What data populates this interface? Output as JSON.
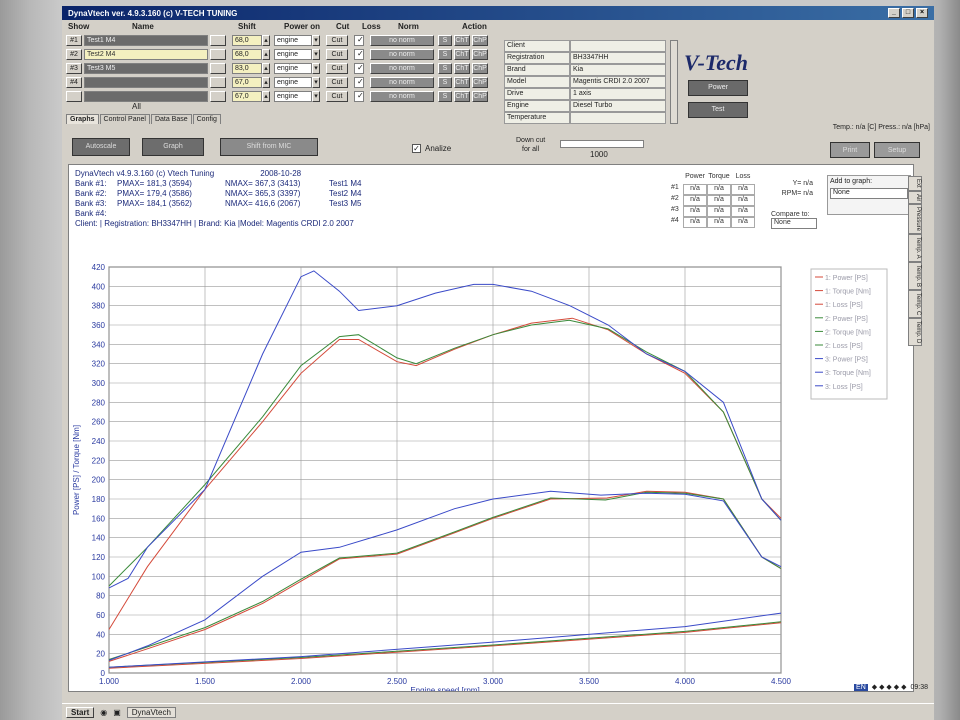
{
  "window": {
    "title": "DynaVtech ver. 4.9.3.160 (c) V-TECH TUNING"
  },
  "table_headers": {
    "show": "Show",
    "name": "Name",
    "shift": "Shift",
    "power_on": "Power on",
    "cut": "Cut",
    "loss": "Loss",
    "norm": "Norm",
    "action": "Action"
  },
  "runs": [
    {
      "id": "#1",
      "name": "Test1 M4",
      "shift": "68,0",
      "power_on": "engine",
      "cut": "Cut",
      "norm": "no norm"
    },
    {
      "id": "#2",
      "name": "Test2 M4",
      "shift": "68,0",
      "power_on": "engine",
      "cut": "Cut",
      "norm": "no norm"
    },
    {
      "id": "#3",
      "name": "Test3 M5",
      "shift": "83,0",
      "power_on": "engine",
      "cut": "Cut",
      "norm": "no norm"
    },
    {
      "id": "#4",
      "name": "",
      "shift": "67,0",
      "power_on": "engine",
      "cut": "Cut",
      "norm": "no norm"
    },
    {
      "id": "",
      "name": "",
      "shift": "67,0",
      "power_on": "engine",
      "cut": "Cut",
      "norm": "no norm"
    }
  ],
  "all_label": "All",
  "action_labels": {
    "s": "S",
    "cht": "ChT",
    "chp": "ChP"
  },
  "vehicle_info": [
    {
      "key": "Client",
      "value": ""
    },
    {
      "key": "Registration",
      "value": "BH3347HH"
    },
    {
      "key": "Brand",
      "value": "Kia"
    },
    {
      "key": "Model",
      "value": "Magentis CRDI 2.0 2007"
    },
    {
      "key": "Drive",
      "value": "1 axis"
    },
    {
      "key": "Engine",
      "value": "Diesel Turbo"
    },
    {
      "key": "Temperature",
      "value": ""
    }
  ],
  "logo": "V-Tech",
  "power_button": "Power",
  "test_button": "Test",
  "tabs": [
    "Graphs",
    "Control Panel",
    "Data Base",
    "Config"
  ],
  "temps_text": "Temp.: n/a [C]   Press.: n/a [hPa]",
  "toolbar": {
    "autoscale": "Autoscale",
    "graph": "Graph",
    "shift_from_mic": "Shift from MIC",
    "analize": "Analize",
    "down_cut_label": "Down cut",
    "for_all": "for all",
    "down_cut_value": "1000",
    "print": "Print",
    "setup": "Setup"
  },
  "info": {
    "app_line": "DynaVtech v4.9.3.160 (c) Vtech Tuning",
    "date": "2008-10-28",
    "banks": [
      {
        "label": "Bank #1:",
        "pmax": "PMAX= 181,3 (3594)",
        "nmax": "NMAX= 367,3 (3413)",
        "name": "Test1 M4"
      },
      {
        "label": "Bank #2:",
        "pmax": "PMAX= 179,4 (3586)",
        "nmax": "NMAX= 365,3 (3397)",
        "name": "Test2 M4"
      },
      {
        "label": "Bank #3:",
        "pmax": "PMAX= 184,1 (3562)",
        "nmax": "NMAX= 416,6 (2067)",
        "name": "Test3 M5"
      },
      {
        "label": "Bank #4:",
        "pmax": "",
        "nmax": "",
        "name": ""
      }
    ],
    "client_line": "Client:   | Registration:  BH3347HH | Brand: Kia |Model:  Magentis CRDI 2.0 2007"
  },
  "cursor_table": {
    "headers": [
      "Power",
      "Torque",
      "Loss"
    ],
    "rows": [
      [
        "#1",
        "n/a",
        "n/a",
        "n/a"
      ],
      [
        "#2",
        "n/a",
        "n/a",
        "n/a"
      ],
      [
        "#3",
        "n/a",
        "n/a",
        "n/a"
      ],
      [
        "#4",
        "n/a",
        "n/a",
        "n/a"
      ]
    ]
  },
  "cursor_readout": {
    "y": "Y= n/a",
    "rpm": "RPM= n/a",
    "compare_to": "Compare to:",
    "compare_value": "None"
  },
  "add_to_graph": {
    "label": "Add to graph:",
    "value": "None"
  },
  "right_tabs": [
    "Ext",
    "Air",
    "Pressure",
    "Temp. A",
    "Temp. B",
    "Temp. C",
    "Temp. D"
  ],
  "legend": [
    "1: Power [PS]",
    "1: Torque [Nm]",
    "1: Loss [PS]",
    "2: Power [PS]",
    "2: Torque [Nm]",
    "2: Loss [PS]",
    "3: Power [PS]",
    "3: Torque [Nm]",
    "3: Loss [PS]"
  ],
  "colors": {
    "series1": "#d44a3a",
    "series2": "#3a8a3a",
    "series3": "#3a4ac8",
    "grid": "#9a9a9a",
    "axis_text": "#2a3aa0"
  },
  "chart_data": {
    "type": "line",
    "xlabel": "Engine speed [rpm]",
    "ylabel": "Power [PS] / Torque [Nm]",
    "xlim": [
      1000,
      4500
    ],
    "ylim": [
      0,
      420
    ],
    "x_ticks": [
      "1.000",
      "1.500",
      "2.000",
      "2.500",
      "3.000",
      "3.500",
      "4.000",
      "4.500"
    ],
    "y_ticks": [
      0,
      20,
      40,
      60,
      80,
      100,
      120,
      140,
      160,
      180,
      200,
      220,
      240,
      260,
      280,
      300,
      320,
      340,
      360,
      380,
      400,
      420
    ],
    "series": [
      {
        "name": "1: Torque [Nm]",
        "color": "#d44a3a",
        "x": [
          1000,
          1200,
          1500,
          1800,
          2000,
          2200,
          2300,
          2500,
          2600,
          2800,
          3000,
          3200,
          3413,
          3600,
          3800,
          4000,
          4200,
          4400,
          4500
        ],
        "y": [
          45,
          110,
          190,
          260,
          310,
          345,
          345,
          322,
          318,
          335,
          350,
          362,
          367,
          355,
          330,
          310,
          270,
          180,
          160
        ]
      },
      {
        "name": "2: Torque [Nm]",
        "color": "#3a8a3a",
        "x": [
          1000,
          1200,
          1500,
          1800,
          2000,
          2200,
          2300,
          2500,
          2600,
          2800,
          3000,
          3200,
          3397,
          3600,
          3800,
          4000,
          4200,
          4400,
          4500
        ],
        "y": [
          90,
          130,
          195,
          265,
          318,
          348,
          350,
          326,
          320,
          336,
          350,
          360,
          365,
          356,
          332,
          312,
          270,
          180,
          158
        ]
      },
      {
        "name": "3: Torque [Nm]",
        "color": "#3a4ac8",
        "x": [
          1000,
          1100,
          1200,
          1500,
          1800,
          2000,
          2067,
          2200,
          2300,
          2500,
          2700,
          2900,
          3000,
          3200,
          3400,
          3600,
          3800,
          4000,
          4200,
          4400,
          4500
        ],
        "y": [
          88,
          98,
          130,
          190,
          330,
          410,
          416,
          395,
          375,
          380,
          393,
          402,
          402,
          395,
          380,
          360,
          330,
          312,
          280,
          180,
          158
        ]
      },
      {
        "name": "1: Power [PS]",
        "color": "#d44a3a",
        "x": [
          1000,
          1200,
          1500,
          1800,
          2000,
          2200,
          2500,
          2800,
          3000,
          3300,
          3594,
          3800,
          4000,
          4200,
          4400,
          4500
        ],
        "y": [
          12,
          25,
          45,
          72,
          95,
          118,
          123,
          145,
          160,
          180,
          181,
          188,
          187,
          180,
          120,
          108
        ]
      },
      {
        "name": "2: Power [PS]",
        "color": "#3a8a3a",
        "x": [
          1000,
          1200,
          1500,
          1800,
          2000,
          2200,
          2500,
          2800,
          3000,
          3300,
          3586,
          3800,
          4000,
          4200,
          4400,
          4500
        ],
        "y": [
          14,
          27,
          47,
          74,
          97,
          119,
          124,
          146,
          161,
          181,
          179,
          187,
          186,
          180,
          120,
          108
        ]
      },
      {
        "name": "3: Power [PS]",
        "color": "#3a4ac8",
        "x": [
          1000,
          1200,
          1500,
          1800,
          2000,
          2200,
          2500,
          2800,
          3000,
          3300,
          3562,
          3800,
          4000,
          4200,
          4400,
          4500
        ],
        "y": [
          13,
          28,
          55,
          100,
          125,
          130,
          148,
          170,
          180,
          188,
          184,
          186,
          185,
          178,
          120,
          110
        ]
      },
      {
        "name": "1: Loss [PS]",
        "color": "#d44a3a",
        "x": [
          1000,
          2000,
          3000,
          4000,
          4500
        ],
        "y": [
          5,
          15,
          28,
          42,
          52
        ]
      },
      {
        "name": "2: Loss [PS]",
        "color": "#3a8a3a",
        "x": [
          1000,
          2000,
          3000,
          4000,
          4500
        ],
        "y": [
          6,
          16,
          29,
          43,
          53
        ]
      },
      {
        "name": "3: Loss [PS]",
        "color": "#3a4ac8",
        "x": [
          1000,
          2000,
          3000,
          4000,
          4500
        ],
        "y": [
          6,
          17,
          32,
          48,
          62
        ]
      }
    ],
    "grid": true,
    "legend_position": "top-right"
  },
  "taskbar": {
    "start": "Start",
    "task": "DynaVtech",
    "time": "09:38",
    "lang": "EN"
  }
}
